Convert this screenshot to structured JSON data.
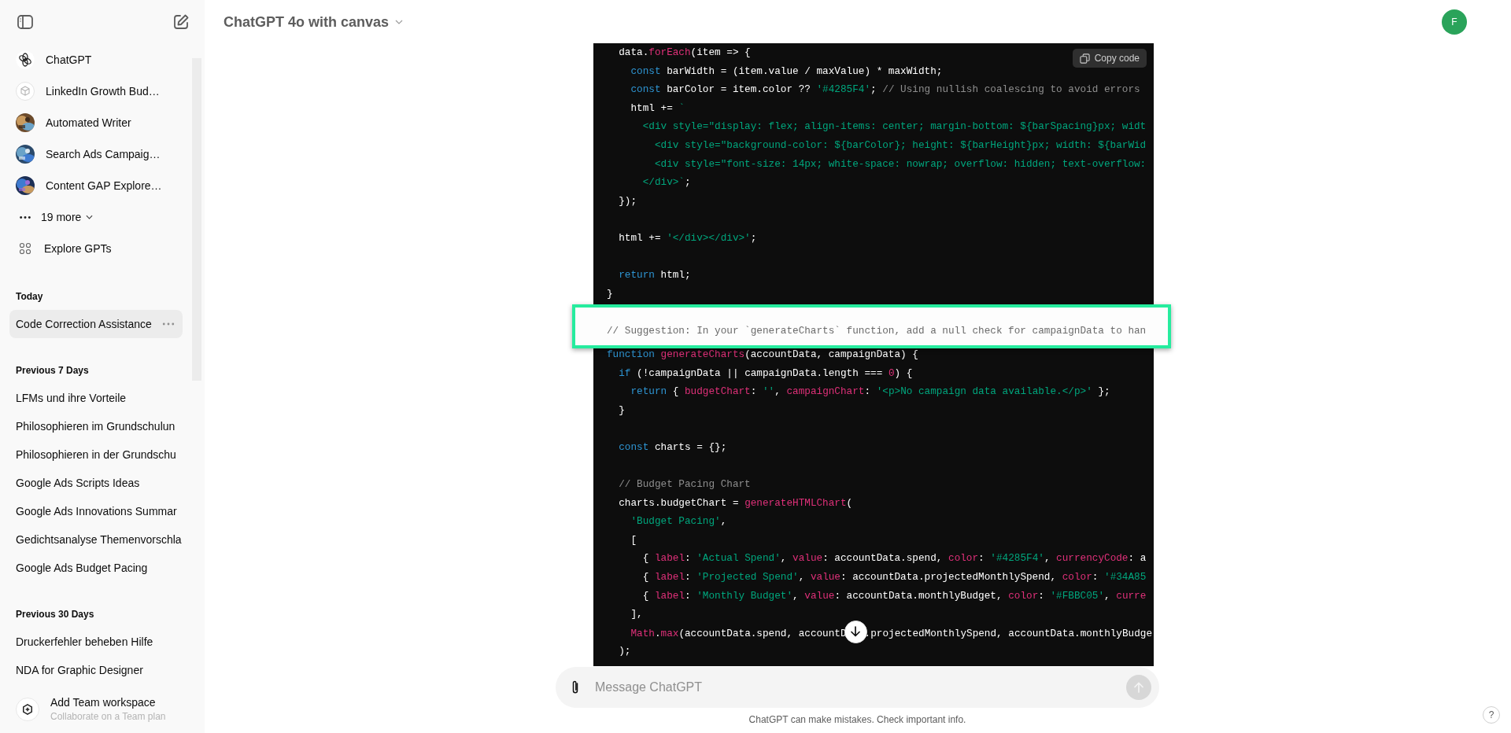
{
  "header": {
    "title": "ChatGPT 4o with canvas",
    "avatar": "F"
  },
  "sidebar": {
    "gpts": [
      {
        "label": "ChatGPT",
        "kind": "logo"
      },
      {
        "label": "LinkedIn Growth Bud…",
        "kind": "cube"
      },
      {
        "label": "Automated Writer",
        "kind": "picture"
      },
      {
        "label": "Search Ads Campaig…",
        "kind": "picture"
      },
      {
        "label": "Content GAP Explore…",
        "kind": "picture"
      }
    ],
    "more": "19 more",
    "explore": "Explore GPTs",
    "sections": [
      {
        "title": "Today",
        "items": [
          {
            "label": "Code Correction Assistance",
            "selected": true
          }
        ]
      },
      {
        "title": "Previous 7 Days",
        "items": [
          {
            "label": "LFMs und ihre Vorteile",
            "selected": false
          },
          {
            "label": "Philosophieren im Grundschulun",
            "selected": false
          },
          {
            "label": "Philosophieren in der Grundschu",
            "selected": false
          },
          {
            "label": "Google Ads Scripts Ideas",
            "selected": false
          },
          {
            "label": "Google Ads Innovations Summar",
            "selected": false
          },
          {
            "label": "Gedichtsanalyse Themenvorschla",
            "selected": false
          },
          {
            "label": "Google Ads Budget Pacing",
            "selected": false
          }
        ]
      },
      {
        "title": "Previous 30 Days",
        "items": [
          {
            "label": "Druckerfehler beheben Hilfe",
            "selected": false
          },
          {
            "label": "NDA for Graphic Designer",
            "selected": false
          }
        ]
      }
    ],
    "team": {
      "title": "Add Team workspace",
      "subtitle": "Collaborate on a Team plan"
    }
  },
  "code": {
    "copy_label": "Copy code",
    "lines": [
      {
        "kind": "code",
        "tokens": [
          {
            "kind": "plain",
            "text": "  data."
          },
          {
            "kind": "fn",
            "text": "forEach"
          },
          {
            "kind": "plain",
            "text": "(item => {"
          }
        ]
      },
      {
        "kind": "code",
        "tokens": [
          {
            "kind": "kw",
            "text": "    const"
          },
          {
            "kind": "plain",
            "text": " barWidth = (item.value / maxValue) * maxWidth;"
          }
        ]
      },
      {
        "kind": "code",
        "tokens": [
          {
            "kind": "kw",
            "text": "    const"
          },
          {
            "kind": "plain",
            "text": " barColor = item.color ?? "
          },
          {
            "kind": "str",
            "text": "'#4285F4'"
          },
          {
            "kind": "plain",
            "text": "; "
          },
          {
            "kind": "cm",
            "text": "// Using nullish coalescing to avoid errors"
          }
        ]
      },
      {
        "kind": "code",
        "tokens": [
          {
            "kind": "plain",
            "text": "    html += "
          },
          {
            "kind": "str",
            "text": "`"
          }
        ]
      },
      {
        "kind": "code",
        "tokens": [
          {
            "kind": "str",
            "text": "      <div style=\"display: flex; align-items: center; margin-bottom: ${barSpacing}px; widt"
          }
        ]
      },
      {
        "kind": "code",
        "tokens": [
          {
            "kind": "str",
            "text": "        <div style=\"background-color: ${barColor}; height: ${barHeight}px; width: ${barWid"
          }
        ]
      },
      {
        "kind": "code",
        "tokens": [
          {
            "kind": "str",
            "text": "        <div style=\"font-size: 14px; white-space: nowrap; overflow: hidden; text-overflow:"
          }
        ]
      },
      {
        "kind": "code",
        "tokens": [
          {
            "kind": "str",
            "text": "      </div>`"
          },
          {
            "kind": "plain",
            "text": ";"
          }
        ]
      },
      {
        "kind": "code",
        "tokens": [
          {
            "kind": "plain",
            "text": "  });"
          }
        ]
      },
      {
        "kind": "blank"
      },
      {
        "kind": "code",
        "tokens": [
          {
            "kind": "plain",
            "text": "  html += "
          },
          {
            "kind": "str",
            "text": "'</div></div>'"
          },
          {
            "kind": "plain",
            "text": ";"
          }
        ]
      },
      {
        "kind": "blank"
      },
      {
        "kind": "code",
        "tokens": [
          {
            "kind": "kw",
            "text": "  return"
          },
          {
            "kind": "plain",
            "text": " html;"
          }
        ]
      },
      {
        "kind": "code",
        "tokens": [
          {
            "kind": "plain",
            "text": "}"
          }
        ]
      },
      {
        "kind": "blank"
      },
      {
        "kind": "suggestion",
        "tokens": [
          {
            "kind": "cm",
            "text": "// Suggestion: In your `generateCharts` function, add a null check for campaignData to han"
          }
        ]
      },
      {
        "kind": "code",
        "tokens": [
          {
            "kind": "kw",
            "text": "function"
          },
          {
            "kind": "fn",
            "text": " generateCharts"
          },
          {
            "kind": "plain",
            "text": "(accountData, campaignData) {"
          }
        ]
      },
      {
        "kind": "code",
        "tokens": [
          {
            "kind": "kw",
            "text": "  if"
          },
          {
            "kind": "plain",
            "text": " (!campaignData || campaignData.length === "
          },
          {
            "kind": "num",
            "text": "0"
          },
          {
            "kind": "plain",
            "text": ") {"
          }
        ]
      },
      {
        "kind": "code",
        "tokens": [
          {
            "kind": "kw",
            "text": "    return"
          },
          {
            "kind": "plain",
            "text": " { "
          },
          {
            "kind": "prop",
            "text": "budgetChart"
          },
          {
            "kind": "plain",
            "text": ": "
          },
          {
            "kind": "str",
            "text": "''"
          },
          {
            "kind": "plain",
            "text": ", "
          },
          {
            "kind": "prop",
            "text": "campaignChart"
          },
          {
            "kind": "plain",
            "text": ": "
          },
          {
            "kind": "str",
            "text": "'<p>No campaign data available.</p>'"
          },
          {
            "kind": "plain",
            "text": " };"
          }
        ]
      },
      {
        "kind": "code",
        "tokens": [
          {
            "kind": "plain",
            "text": "  }"
          }
        ]
      },
      {
        "kind": "blank"
      },
      {
        "kind": "code",
        "tokens": [
          {
            "kind": "kw",
            "text": "  const"
          },
          {
            "kind": "plain",
            "text": " charts = {};"
          }
        ]
      },
      {
        "kind": "blank"
      },
      {
        "kind": "code",
        "tokens": [
          {
            "kind": "cm",
            "text": "  // Budget Pacing Chart"
          }
        ]
      },
      {
        "kind": "code",
        "tokens": [
          {
            "kind": "plain",
            "text": "  charts.budgetChart = "
          },
          {
            "kind": "fn",
            "text": "generateHTMLChart"
          },
          {
            "kind": "plain",
            "text": "("
          }
        ]
      },
      {
        "kind": "code",
        "tokens": [
          {
            "kind": "str",
            "text": "    'Budget Pacing'"
          },
          {
            "kind": "plain",
            "text": ","
          }
        ]
      },
      {
        "kind": "code",
        "tokens": [
          {
            "kind": "plain",
            "text": "    ["
          }
        ]
      },
      {
        "kind": "code",
        "tokens": [
          {
            "kind": "plain",
            "text": "      { "
          },
          {
            "kind": "prop",
            "text": "label"
          },
          {
            "kind": "plain",
            "text": ": "
          },
          {
            "kind": "str",
            "text": "'Actual Spend'"
          },
          {
            "kind": "plain",
            "text": ", "
          },
          {
            "kind": "prop",
            "text": "value"
          },
          {
            "kind": "plain",
            "text": ": accountData.spend, "
          },
          {
            "kind": "prop",
            "text": "color"
          },
          {
            "kind": "plain",
            "text": ": "
          },
          {
            "kind": "str",
            "text": "'#4285F4'"
          },
          {
            "kind": "plain",
            "text": ", "
          },
          {
            "kind": "prop",
            "text": "currencyCode"
          },
          {
            "kind": "plain",
            "text": ": a"
          }
        ]
      },
      {
        "kind": "code",
        "tokens": [
          {
            "kind": "plain",
            "text": "      { "
          },
          {
            "kind": "prop",
            "text": "label"
          },
          {
            "kind": "plain",
            "text": ": "
          },
          {
            "kind": "str",
            "text": "'Projected Spend'"
          },
          {
            "kind": "plain",
            "text": ", "
          },
          {
            "kind": "prop",
            "text": "value"
          },
          {
            "kind": "plain",
            "text": ": accountData.projectedMonthlySpend, "
          },
          {
            "kind": "prop",
            "text": "color"
          },
          {
            "kind": "plain",
            "text": ": "
          },
          {
            "kind": "str",
            "text": "'#34A85"
          }
        ]
      },
      {
        "kind": "code",
        "tokens": [
          {
            "kind": "plain",
            "text": "      { "
          },
          {
            "kind": "prop",
            "text": "label"
          },
          {
            "kind": "plain",
            "text": ": "
          },
          {
            "kind": "str",
            "text": "'Monthly Budget'"
          },
          {
            "kind": "plain",
            "text": ", "
          },
          {
            "kind": "prop",
            "text": "value"
          },
          {
            "kind": "plain",
            "text": ": accountData.monthlyBudget, "
          },
          {
            "kind": "prop",
            "text": "color"
          },
          {
            "kind": "plain",
            "text": ": "
          },
          {
            "kind": "str",
            "text": "'#FBBC05'"
          },
          {
            "kind": "plain",
            "text": ", "
          },
          {
            "kind": "prop",
            "text": "curre"
          }
        ]
      },
      {
        "kind": "code",
        "tokens": [
          {
            "kind": "plain",
            "text": "    ],"
          }
        ]
      },
      {
        "kind": "code",
        "tokens": [
          {
            "kind": "fn",
            "text": "    Math"
          },
          {
            "kind": "plain",
            "text": "."
          },
          {
            "kind": "fn",
            "text": "max"
          },
          {
            "kind": "plain",
            "text": "(accountData.spend, accountD"
          },
          {
            "kind": "scroll_button"
          },
          {
            "kind": "plain",
            "text": ".projectedMonthlySpend, accountData.monthlyBudge"
          }
        ]
      },
      {
        "kind": "code",
        "tokens": [
          {
            "kind": "plain",
            "text": "  );"
          }
        ]
      }
    ]
  },
  "composer": {
    "placeholder": "Message ChatGPT"
  },
  "disclaimer": "ChatGPT can make mistakes. Check important info.",
  "help": "?"
}
